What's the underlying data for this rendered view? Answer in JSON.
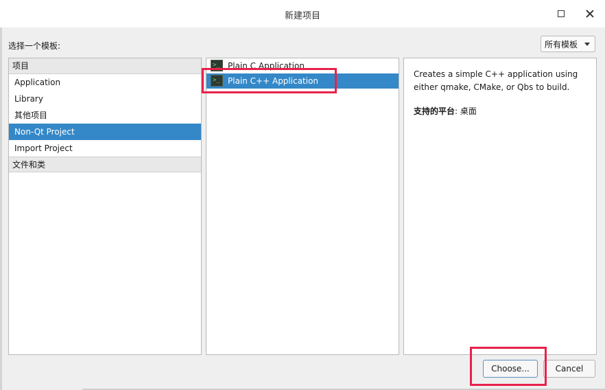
{
  "window": {
    "title": "新建项目"
  },
  "filter": {
    "label": "选择一个模板:",
    "value": "所有模板"
  },
  "categories": {
    "header1": "项目",
    "items": [
      "Application",
      "Library",
      "其他项目",
      "Non-Qt Project",
      "Import Project"
    ],
    "selected_index": 3,
    "header2": "文件和类"
  },
  "templates": {
    "items": [
      {
        "label": "Plain C Application",
        "icon": "terminal-icon"
      },
      {
        "label": "Plain C++ Application",
        "icon": "terminal-icon"
      }
    ],
    "selected_index": 1
  },
  "description": {
    "text": "Creates a simple C++ application using either qmake, CMake, or Qbs to build.",
    "platforms_label": "支持的平台",
    "platforms_value": ": 桌面"
  },
  "buttons": {
    "choose": "Choose...",
    "cancel": "Cancel"
  },
  "colors": {
    "selection": "#3488c8",
    "highlight": "#e8214b"
  }
}
